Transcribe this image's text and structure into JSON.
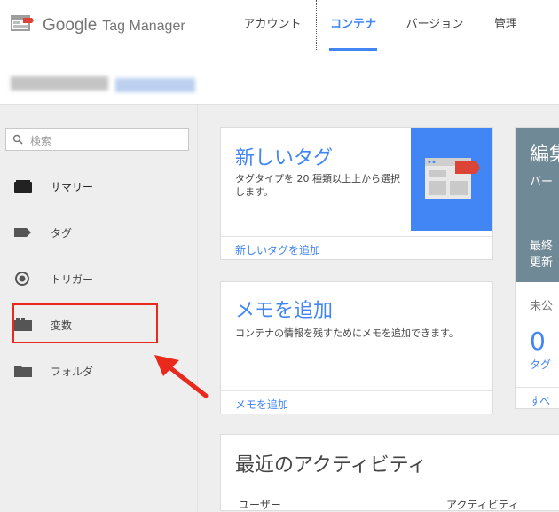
{
  "app": {
    "logo_google": "Google",
    "logo_product": "Tag Manager"
  },
  "nav": {
    "items": [
      {
        "label": "アカウント"
      },
      {
        "label": "コンテナ"
      },
      {
        "label": "バージョン"
      },
      {
        "label": "管理"
      }
    ],
    "active": "コンテナ"
  },
  "search": {
    "placeholder": "検索"
  },
  "sidebar": {
    "items": [
      {
        "label": "サマリー",
        "icon": "summary-icon"
      },
      {
        "label": "タグ",
        "icon": "tag-icon"
      },
      {
        "label": "トリガー",
        "icon": "trigger-icon"
      },
      {
        "label": "変数",
        "icon": "variable-icon"
      },
      {
        "label": "フォルダ",
        "icon": "folder-icon"
      }
    ],
    "highlighted": "変数"
  },
  "new_tag_card": {
    "title": "新しいタグ",
    "description": "タグタイプを 20 種類以上上から選択します。",
    "link": "新しいタグを追加"
  },
  "note_card": {
    "title": "メモを追加",
    "description": "コンテナの情報を残すためにメモを追加できます。",
    "link": "メモを追加"
  },
  "edit_card": {
    "title": "編集",
    "subtitle": "バー",
    "latest_line1": "最終",
    "latest_line2": "更新",
    "unpublished": "未公",
    "count": "0",
    "count_label": "タグ",
    "link": "すべ"
  },
  "activity_card": {
    "title": "最近のアクティビティ",
    "col_user": "ユーザー",
    "col_activity": "アクティビティ"
  },
  "colors": {
    "accent": "#4285f4",
    "annotation_red": "#e8291c",
    "edit_header": "#6f8a96"
  }
}
